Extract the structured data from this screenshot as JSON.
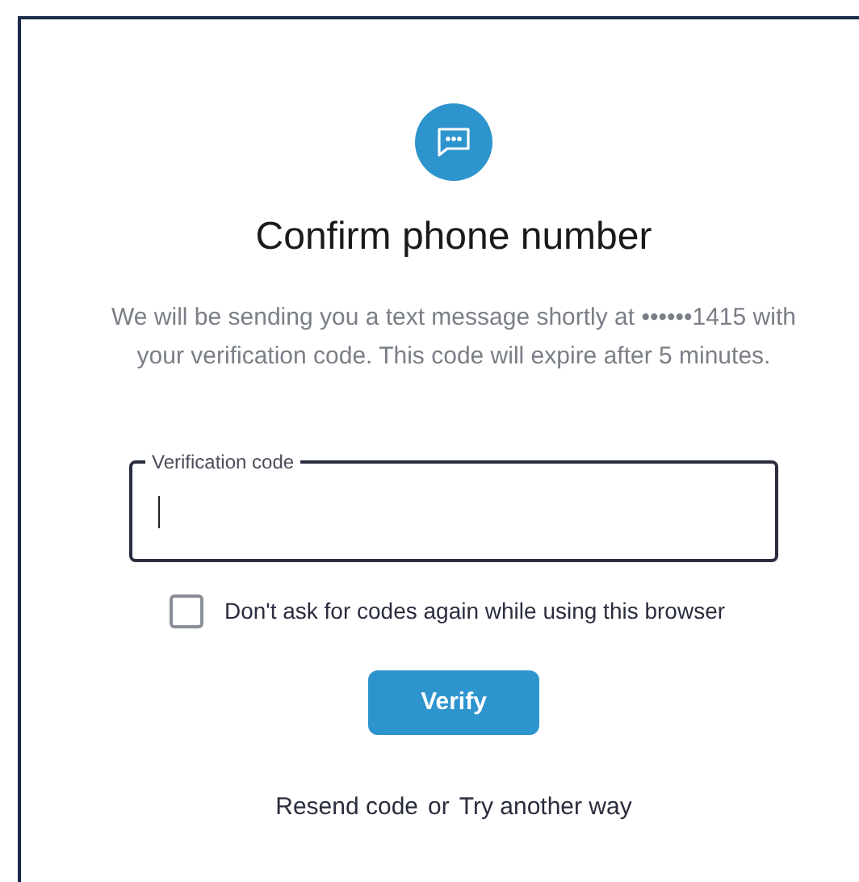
{
  "title": "Confirm phone number",
  "message": "We will be sending you a text message shortly at ••••••1415 with your verification code. This code will expire after 5 minutes.",
  "code_field": {
    "label": "Verification code",
    "focused": true
  },
  "remember_checkbox": {
    "label": "Don't ask for codes again while using this browser",
    "checked": false
  },
  "verify_button": "Verify",
  "resend_link": "Resend code",
  "separator": "or",
  "other_way_link": "Try another way"
}
